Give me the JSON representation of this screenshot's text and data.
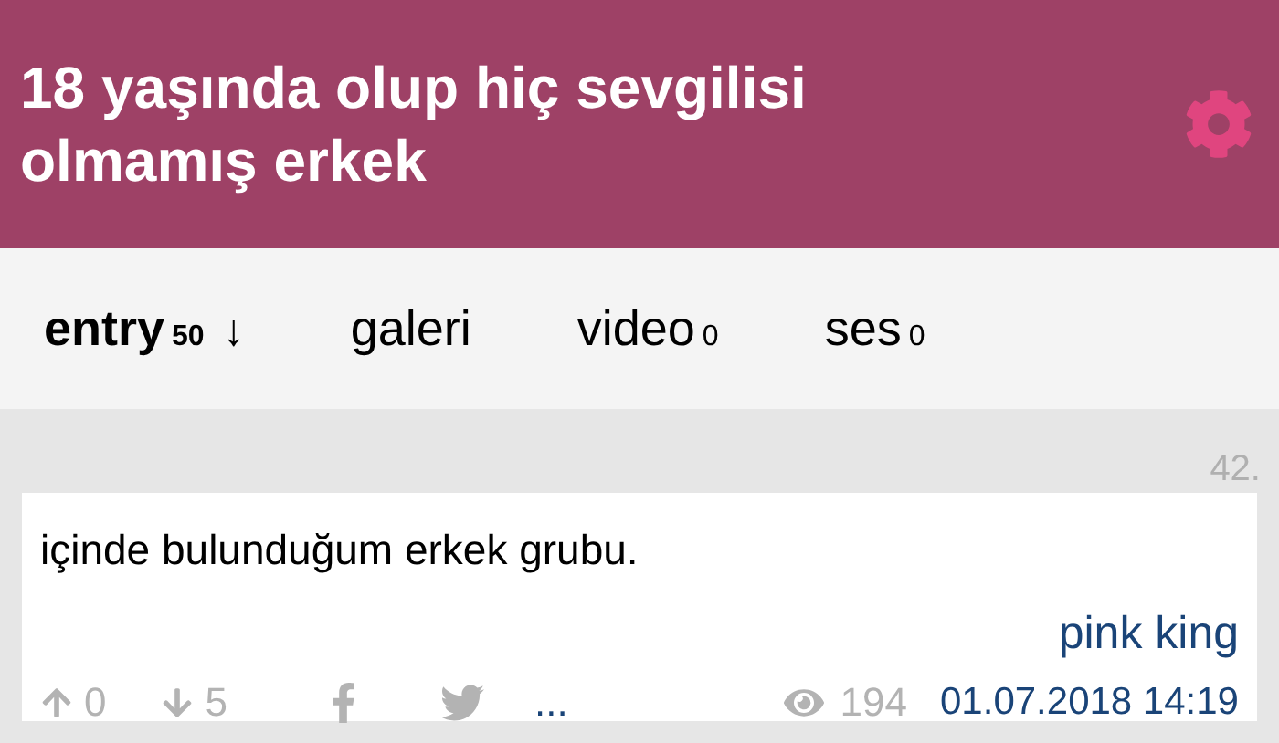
{
  "header": {
    "title": "18 yaşında olup hiç sevgilisi olmamış erkek"
  },
  "tabs": [
    {
      "label": "entry",
      "count": "50",
      "sort": "↓",
      "selected": true
    },
    {
      "label": "galeri",
      "selected": false
    },
    {
      "label": "video",
      "count": "0",
      "selected": false
    },
    {
      "label": "ses",
      "count": "0",
      "selected": false
    }
  ],
  "entry": {
    "number": "42.",
    "text": "içinde bulunduğum erkek grubu.",
    "author": "pink king",
    "upvotes": "0",
    "downvotes": "5",
    "more": "...",
    "views": "194",
    "date": "01.07.2018 14:19"
  }
}
